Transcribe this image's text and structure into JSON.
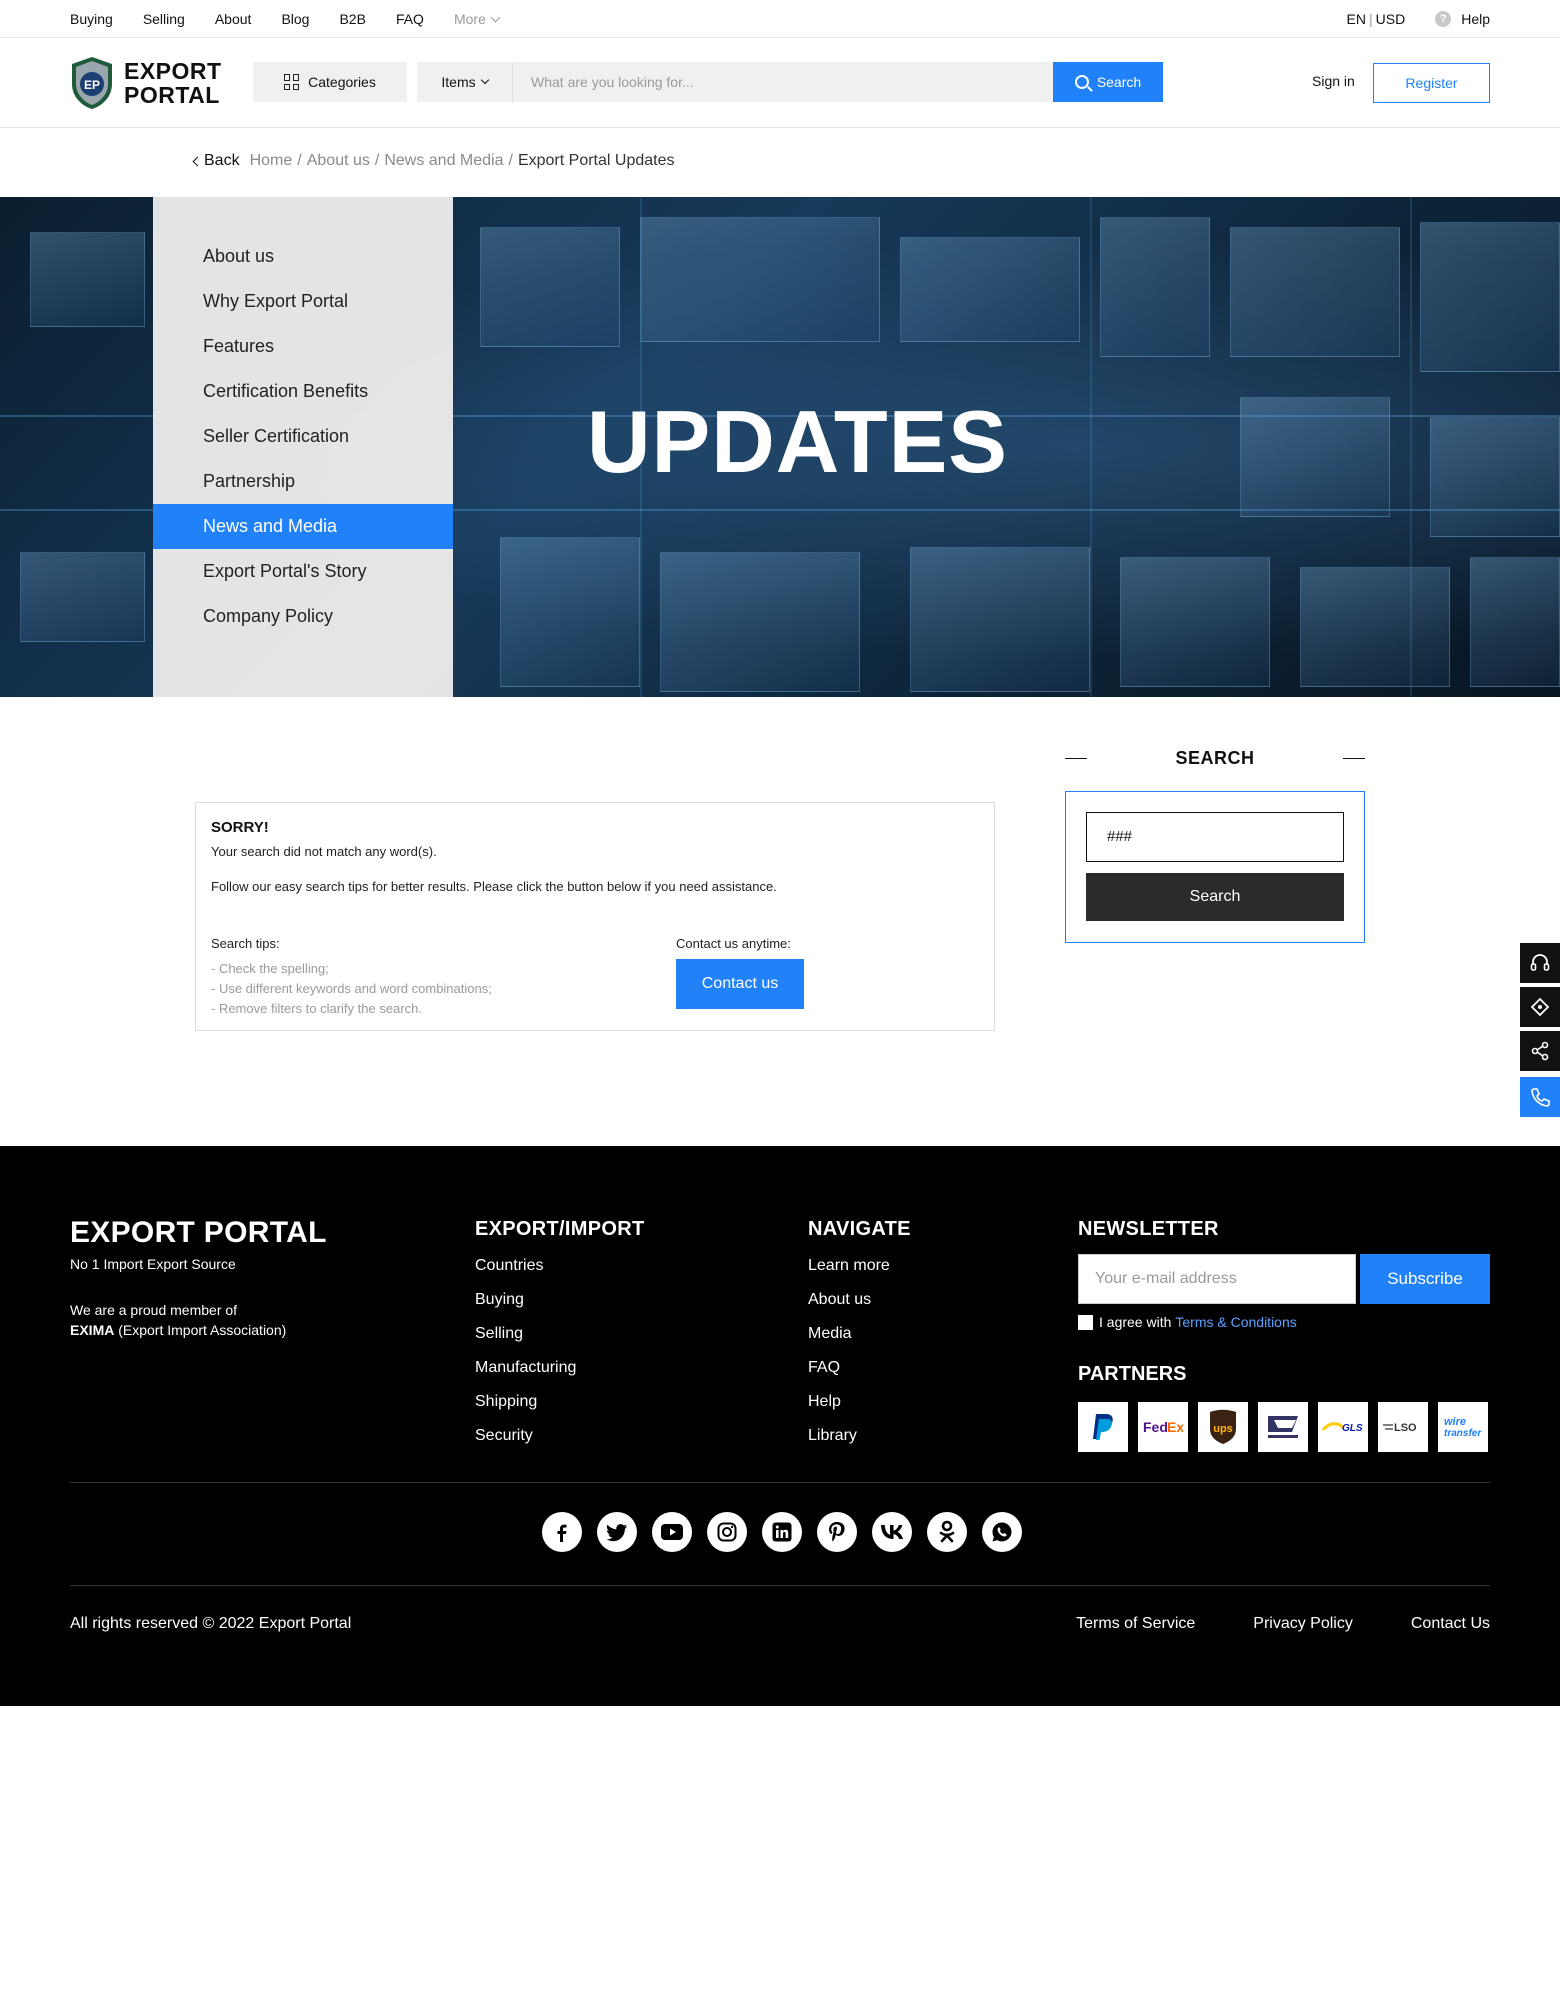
{
  "topbar": {
    "nav": [
      "Buying",
      "Selling",
      "About",
      "Blog",
      "B2B",
      "FAQ"
    ],
    "more_label": "More",
    "lang": "EN",
    "currency": "USD",
    "help_label": "Help"
  },
  "header": {
    "logo_line1": "EXPORT",
    "logo_line2": "PORTAL",
    "logo_mark": "EP",
    "categories_label": "Categories",
    "search_type": "Items",
    "search_placeholder": "What are you looking for...",
    "search_button": "Search",
    "signin_label": "Sign in",
    "register_label": "Register"
  },
  "breadcrumbs": {
    "back": "Back",
    "items": [
      "Home",
      "About us",
      "News and Media"
    ],
    "current": "Export Portal Updates"
  },
  "hero": {
    "title": "UPDATES",
    "menu": [
      "About us",
      "Why Export Portal",
      "Features",
      "Certification Benefits",
      "Seller Certification",
      "Partnership",
      "News and Media",
      "Export Portal's Story",
      "Company Policy"
    ],
    "active_index": 6
  },
  "no_results": {
    "heading": "SORRY!",
    "line1": "Your search did not match any word(s).",
    "line2": "Follow our easy search tips for better results. Please click the button below if you need assistance.",
    "tips_title": "Search tips:",
    "tips": [
      "- Check the spelling;",
      "- Use different keywords and word combinations;",
      "- Remove filters to clarify the search."
    ],
    "contact_title": "Contact us anytime:",
    "contact_button": "Contact us"
  },
  "search_widget": {
    "title": "SEARCH",
    "value": "###",
    "button": "Search"
  },
  "footer": {
    "brand": "EXPORT PORTAL",
    "tagline": "No 1 Import Export Source",
    "member_line": "We are a proud member of",
    "eximo_bold": "EXIMA",
    "eximo_rest": " (Export Import Association)",
    "export_import": {
      "title": "EXPORT/IMPORT",
      "links": [
        "Countries",
        "Buying",
        "Selling",
        "Manufacturing",
        "Shipping",
        "Security"
      ]
    },
    "navigate": {
      "title": "NAVIGATE",
      "links": [
        "Learn more",
        "About us",
        "Media",
        "FAQ",
        "Help",
        "Library"
      ]
    },
    "newsletter": {
      "title": "NEWSLETTER",
      "placeholder": "Your e-mail address",
      "button": "Subscribe",
      "agree": "I agree with",
      "terms": "Terms & Conditions"
    },
    "partners_title": "PARTNERS",
    "partners": [
      "paypal-logo",
      "fedex-logo",
      "ups-logo",
      "usps-logo",
      "gls-logo",
      "lso-logo",
      "wire-transfer-logo"
    ],
    "socials": [
      "facebook-icon",
      "twitter-icon",
      "youtube-icon",
      "instagram-icon",
      "linkedin-icon",
      "pinterest-icon",
      "vk-icon",
      "odnoklassniki-icon",
      "whatsapp-icon"
    ],
    "copyright": "All rights reserved © 2022 Export Portal",
    "legal": [
      "Terms of Service",
      "Privacy Policy",
      "Contact Us"
    ]
  },
  "colors": {
    "accent": "#2181f8",
    "footer_bg": "#000000",
    "dark_button": "#2b2b2b"
  }
}
